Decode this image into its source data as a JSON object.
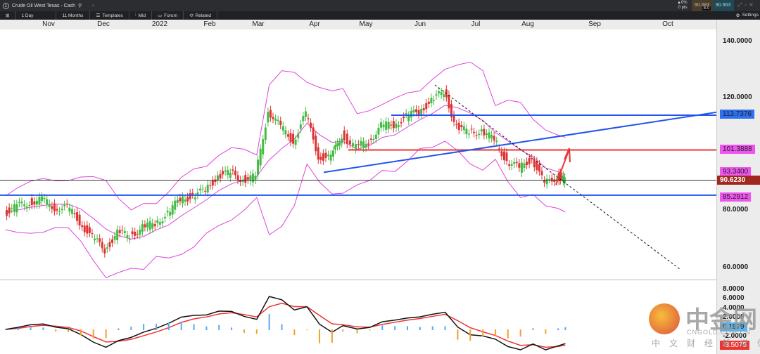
{
  "window": {
    "tab_title": "Crude Oil West Texas - Cash",
    "tab_number": "1",
    "add_tab": "+",
    "change_pct": "▲0%",
    "change_pts": "0 pts",
    "bid": "90.683",
    "ask": "90.663",
    "spread": "8.0",
    "bid_color": "#4a3d2a",
    "ask_color": "#1e4a55"
  },
  "toolbar": {
    "interval": "1 Day",
    "range": "11 Months",
    "templates": "Templates",
    "mid": "Mid",
    "forum": "Forum",
    "related": "Related",
    "settings": "Settings"
  },
  "time_axis": [
    "Nov",
    "Dec",
    "2022",
    "Feb",
    "Mar",
    "Apr",
    "May",
    "Jun",
    "Jul",
    "Aug",
    "Sep",
    "Oct"
  ],
  "price_axis": [
    "140.0000",
    "120.0000",
    "80.0000",
    "60.0000"
  ],
  "price_tags": {
    "resistance_high": "113.7376",
    "resistance_mid": "101.3888",
    "band_upper": "93.3400",
    "last_price": "90.6230",
    "support": "85.2912"
  },
  "macd_axis": [
    "8.0000",
    "6.0000",
    "4.0000",
    "2.0000",
    "-2.0000"
  ],
  "macd_tags": {
    "histogram": "0.1979",
    "macd": "-3.5075"
  },
  "watermark": {
    "brand": "中金网",
    "domain": "CNGOLD.COM.CN",
    "slogan": "中文财经新媒体"
  },
  "colors": {
    "up": "#44bb44",
    "down": "#dd3333",
    "bands": "#dd44dd",
    "blue_line": "#2255ee",
    "red_line": "#ee3333",
    "last": "#a0281e"
  },
  "chart_data": {
    "type": "candlestick",
    "instrument": "Crude Oil West Texas - Cash",
    "dates": [
      "2021-10-08",
      "2021-10-15",
      "2021-10-22",
      "2021-10-29",
      "2021-11-05",
      "2021-11-12",
      "2021-11-19",
      "2021-11-26",
      "2021-12-03",
      "2021-12-10",
      "2021-12-17",
      "2021-12-24",
      "2021-12-31",
      "2022-01-07",
      "2022-01-14",
      "2022-01-21",
      "2022-01-28",
      "2022-02-04",
      "2022-02-11",
      "2022-02-18",
      "2022-02-25",
      "2022-03-04",
      "2022-03-11",
      "2022-03-18",
      "2022-03-25",
      "2022-04-01",
      "2022-04-08",
      "2022-04-14",
      "2022-04-22",
      "2022-04-29",
      "2022-05-06",
      "2022-05-13",
      "2022-05-20",
      "2022-05-27",
      "2022-06-03",
      "2022-06-10",
      "2022-06-17",
      "2022-06-24",
      "2022-07-01",
      "2022-07-08",
      "2022-07-15",
      "2022-07-22",
      "2022-07-29",
      "2022-08-05",
      "2022-08-12",
      "2022-08-16"
    ],
    "close": [
      79,
      81,
      83,
      83.5,
      81,
      80.8,
      76,
      70,
      66,
      71.7,
      70.9,
      73.8,
      75.2,
      78.9,
      83.8,
      85.1,
      86.8,
      92.3,
      93.1,
      91,
      91.6,
      115.7,
      109.3,
      104.7,
      113.9,
      99.3,
      98.3,
      106.9,
      102,
      104.7,
      109.8,
      110.5,
      113.2,
      115.1,
      118.9,
      122,
      109.6,
      107.6,
      108.4,
      104.8,
      97.6,
      94.7,
      98.6,
      89,
      92.1,
      90.6
    ],
    "ylim": [
      55,
      145
    ],
    "levels": {
      "resistance_high": 113.7376,
      "resistance_mid": 101.3888,
      "support": 85.2912,
      "last": 90.623
    }
  }
}
